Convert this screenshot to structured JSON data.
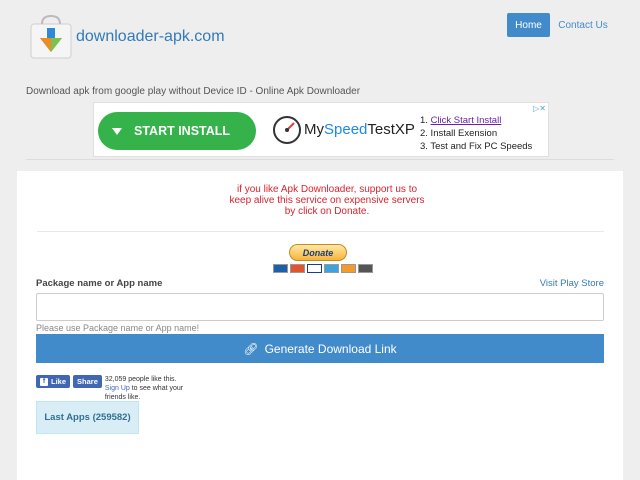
{
  "header": {
    "site_title": "downloader-apk.com",
    "nav": {
      "home": "Home",
      "contact": "Contact Us"
    },
    "tagline": "Download apk from google play without Device ID - Online Apk Downloader"
  },
  "ad": {
    "button_label": "START INSTALL",
    "brand_prefix": "My",
    "brand_highlight": "Speed",
    "brand_suffix": "TestXP",
    "step1_num": "1. ",
    "step1_link": "Click Start Install",
    "step2": "2. Install Exension",
    "step3": "3. Test and Fix PC Speeds",
    "corner": "▷✕"
  },
  "support": {
    "message": "if you like Apk Downloader, support us to keep alive this service on expensive servers by click on Donate.",
    "donate_label": "Donate"
  },
  "form": {
    "package_label": "Package name or App name",
    "visit_link": "Visit Play Store",
    "input_value": "",
    "input_placeholder": "",
    "hint": "Please use Package name or App name!",
    "generate_label": "Generate Download Link"
  },
  "facebook": {
    "like_label": "Like",
    "share_label": "Share",
    "count_text": "32,059 people like this.",
    "signup_link": "Sign Up",
    "signup_rest": " to see what your friends like."
  },
  "last_apps": {
    "label": "Last Apps (259582)"
  },
  "colors": {
    "accent": "#428bca",
    "link": "#337ab7",
    "alert": "#d9232d",
    "ad_green": "#35b34a"
  }
}
